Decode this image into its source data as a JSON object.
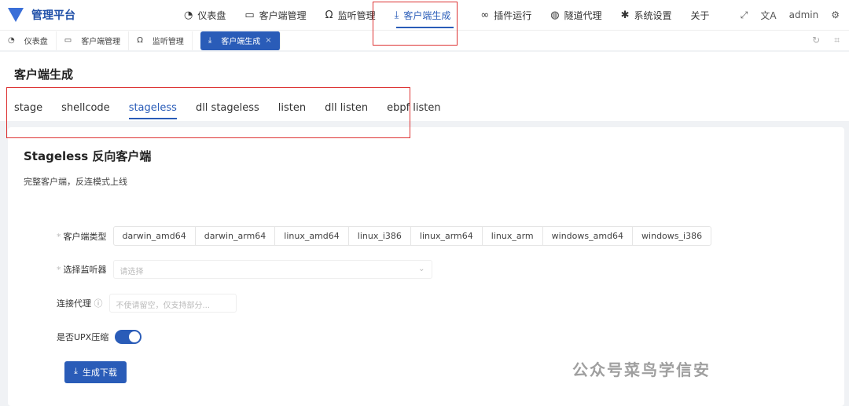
{
  "app": {
    "title": "管理平台"
  },
  "nav": [
    {
      "label": "仪表盘",
      "icon": "dashboard-icon",
      "glyph": "◔"
    },
    {
      "label": "客户端管理",
      "icon": "monitor-icon",
      "glyph": "▭"
    },
    {
      "label": "监听管理",
      "icon": "headphones-icon",
      "glyph": "Ω"
    },
    {
      "label": "客户端生成",
      "icon": "download-icon",
      "glyph": "⤓"
    },
    {
      "label": "插件运行",
      "icon": "link-icon",
      "glyph": "∞"
    },
    {
      "label": "隧道代理",
      "icon": "globe-icon",
      "glyph": "◍"
    },
    {
      "label": "系统设置",
      "icon": "gear-icon",
      "glyph": "✱"
    },
    {
      "label": "关于",
      "icon": "",
      "glyph": ""
    }
  ],
  "user": {
    "name": "admin"
  },
  "tabs": [
    {
      "label": "仪表盘",
      "glyph": "◔"
    },
    {
      "label": "客户端管理",
      "glyph": "▭"
    },
    {
      "label": "监听管理",
      "glyph": "Ω"
    },
    {
      "label": "客户端生成",
      "glyph": "⤓",
      "close": "×"
    }
  ],
  "page": {
    "title": "客户端生成",
    "subtabs": [
      "stage",
      "shellcode",
      "stageless",
      "dll stageless",
      "listen",
      "dll listen",
      "ebpf listen"
    ]
  },
  "card": {
    "title": "Stageless 反向客户端",
    "desc": "完整客户端，反连模式上线"
  },
  "form": {
    "client_type_label": "客户端类型",
    "client_types": [
      "darwin_amd64",
      "darwin_arm64",
      "linux_amd64",
      "linux_i386",
      "linux_arm64",
      "linux_arm",
      "windows_amd64",
      "windows_i386"
    ],
    "listener_label": "选择监听器",
    "listener_placeholder": "请选择",
    "proxy_label": "连接代理",
    "proxy_placeholder": "不使请留空，仅支持部分...",
    "upx_label": "是否UPX压缩",
    "upx_enabled": true,
    "submit": "生成下载"
  },
  "watermark": "公众号菜鸟学信安",
  "colors": {
    "accent": "#2a5cb8",
    "highlight": "#d33333"
  }
}
